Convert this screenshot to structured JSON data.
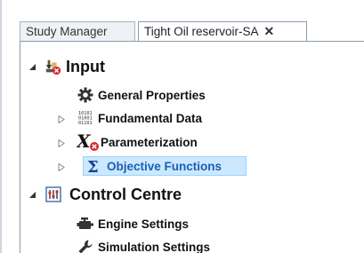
{
  "tabs": [
    {
      "label": "Study Manager",
      "active": false
    },
    {
      "label": "Tight Oil reservoir-SA",
      "active": true,
      "close_symbol": "✕"
    }
  ],
  "tree": [
    {
      "label": "Input",
      "icon": "input-error-icon",
      "expanded": true,
      "level": 0,
      "children": [
        {
          "label": "General Properties",
          "icon": "gear-icon"
        },
        {
          "label": "Fundamental Data",
          "icon": "binary-data-icon",
          "expandable": true
        },
        {
          "label": "Parameterization",
          "icon": "x-variable-error-icon",
          "expandable": true
        },
        {
          "label": "Objective Functions",
          "icon": "sigma-icon",
          "expandable": true,
          "selected": true
        }
      ]
    },
    {
      "label": "Control Centre",
      "icon": "control-panel-icon",
      "expanded": true,
      "level": 0,
      "children": [
        {
          "label": "Engine Settings",
          "icon": "engine-icon"
        },
        {
          "label": "Simulation Settings",
          "icon": "wrench-icon"
        }
      ]
    }
  ],
  "colors": {
    "selection": "#cce8ff",
    "selected_text": "#1a5fb4",
    "error_badge": "#d9262c"
  }
}
